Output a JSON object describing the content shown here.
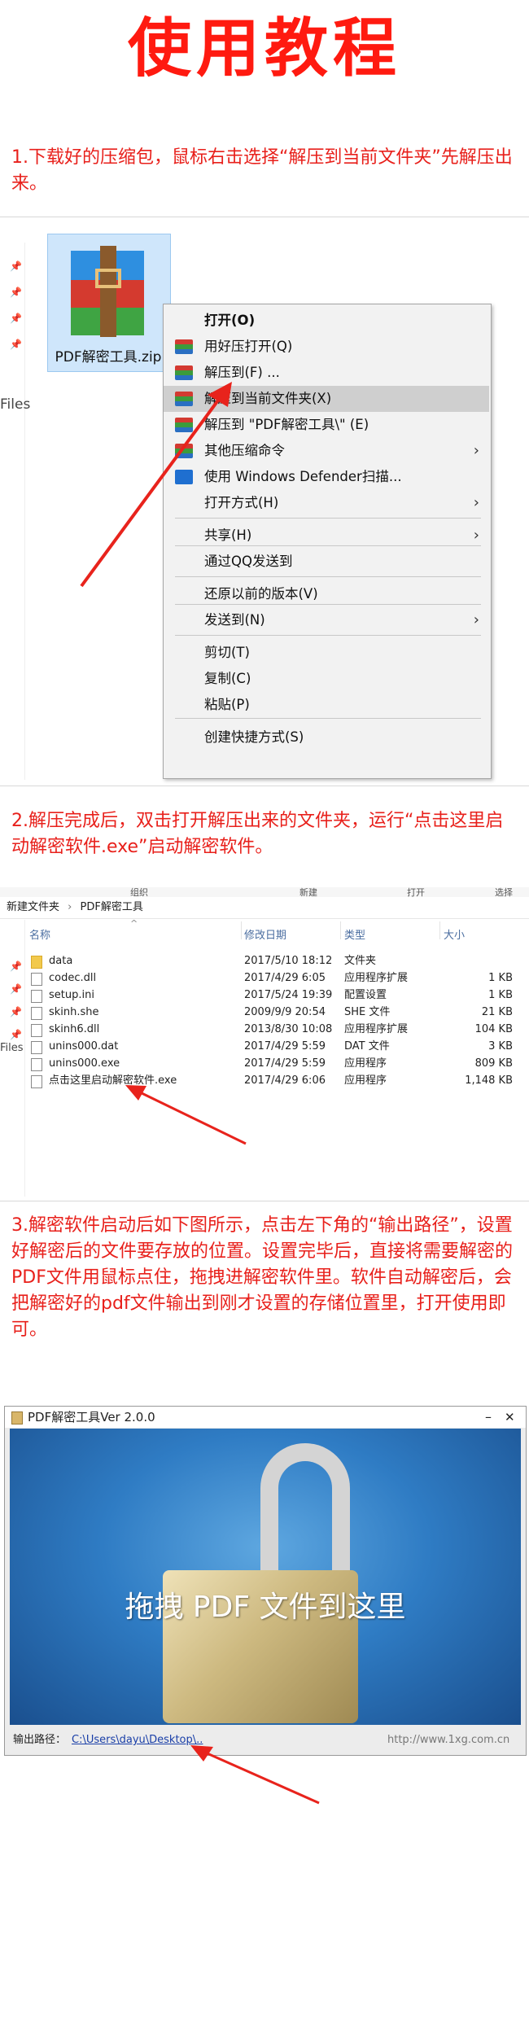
{
  "page": {
    "title": "使用教程",
    "step1": "1.下载好的压缩包，鼠标右击选择“解压到当前文件夹”先解压出来。",
    "step2": "2.解压完成后，双击打开解压出来的文件夹，运行“点击这里启动解密软件.exe”启动解密软件。",
    "step3": "3.解密软件启动后如下图所示，点击左下角的“输出路径”，设置好解密后的文件要存放的位置。设置完毕后，直接将需要解密的PDF文件用鼠标点住，拖拽进解密软件里。软件自动解密后，会把解密好的pdf文件输出到刚才设置的存储位置里，打开使用即可。"
  },
  "section1": {
    "zip_filename": "PDF解密工具.zip",
    "left_label": "Files",
    "menu": [
      {
        "label": "打开(O)",
        "bold": true,
        "icon": ""
      },
      {
        "label": "用好压打开(Q)",
        "icon": "rar-icon"
      },
      {
        "label": "解压到(F) ...",
        "icon": "rar-icon"
      },
      {
        "label": "解压到当前文件夹(X)",
        "icon": "rar-icon",
        "highlighted": true
      },
      {
        "label": "解压到 \"PDF解密工具\\\" (E)",
        "icon": "rar-icon"
      },
      {
        "label": "其他压缩命令",
        "icon": "rar-icon",
        "submenu": true
      },
      {
        "label": "使用 Windows Defender扫描...",
        "icon": "shield-icon"
      },
      {
        "label": "打开方式(H)",
        "icon": "",
        "submenu": true
      },
      {
        "label": "共享(H)",
        "icon": "",
        "submenu": true
      },
      {
        "label": "通过QQ发送到",
        "icon": ""
      },
      {
        "label": "还原以前的版本(V)",
        "icon": ""
      },
      {
        "label": "发送到(N)",
        "icon": "",
        "submenu": true
      },
      {
        "label": "剪切(T)",
        "icon": ""
      },
      {
        "label": "复制(C)",
        "icon": ""
      },
      {
        "label": "粘贴(P)",
        "icon": ""
      },
      {
        "label": "创建快捷方式(S)",
        "icon": ""
      }
    ]
  },
  "section2": {
    "top_labels": [
      "组织",
      "新建",
      "打开",
      "选择"
    ],
    "breadcrumb": [
      "新建文件夹",
      "PDF解密工具"
    ],
    "left_label": "Files",
    "columns": [
      "名称",
      "修改日期",
      "类型",
      "大小"
    ],
    "files": [
      {
        "name": "data",
        "date": "2017/5/10 18:12",
        "type": "文件夹",
        "size": "",
        "folder": true
      },
      {
        "name": "codec.dll",
        "date": "2017/4/29 6:05",
        "type": "应用程序扩展",
        "size": "1 KB"
      },
      {
        "name": "setup.ini",
        "date": "2017/5/24 19:39",
        "type": "配置设置",
        "size": "1 KB"
      },
      {
        "name": "skinh.she",
        "date": "2009/9/9 20:54",
        "type": "SHE 文件",
        "size": "21 KB"
      },
      {
        "name": "skinh6.dll",
        "date": "2013/8/30 10:08",
        "type": "应用程序扩展",
        "size": "104 KB"
      },
      {
        "name": "unins000.dat",
        "date": "2017/4/29 5:59",
        "type": "DAT 文件",
        "size": "3 KB"
      },
      {
        "name": "unins000.exe",
        "date": "2017/4/29 5:59",
        "type": "应用程序",
        "size": "809 KB"
      },
      {
        "name": "点击这里启动解密软件.exe",
        "date": "2017/4/29 6:06",
        "type": "应用程序",
        "size": "1,148 KB"
      }
    ]
  },
  "section3": {
    "window_title": "PDF解密工具Ver 2.0.0",
    "minimize": "–",
    "close": "✕",
    "drag_text": "拖拽 PDF 文件到这里",
    "output_label": "输出路径：",
    "output_path": "C:\\Users\\dayu\\Desktop\\..",
    "url": "http://www.1xg.com.cn"
  },
  "colors": {
    "accent_red": "#e8201b",
    "title_red": "#ff1a10",
    "highlight": "#cfcfcf",
    "link_blue": "#1a3fa8"
  }
}
